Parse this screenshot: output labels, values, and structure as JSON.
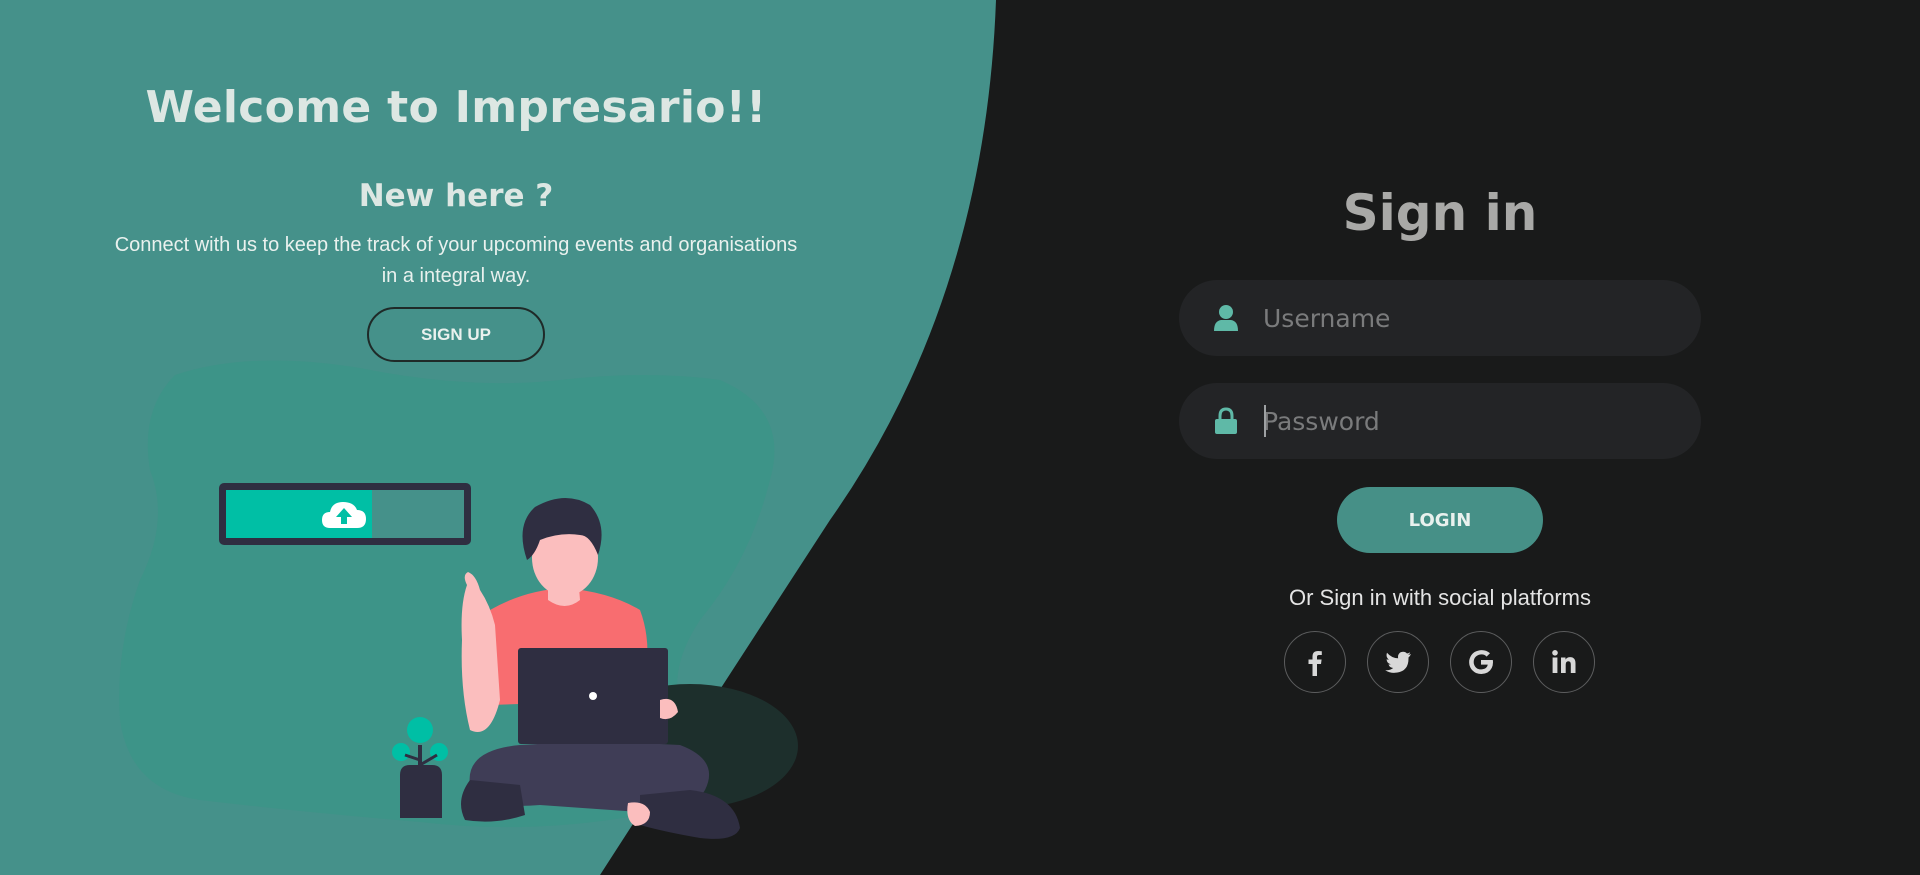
{
  "left": {
    "welcome_title": "Welcome to Impresario!!",
    "new_here": "New here ?",
    "description": "Connect with us to keep the track of your upcoming events and organisations in a integral way.",
    "signup_label": "SIGN UP"
  },
  "right": {
    "title": "Sign in",
    "username": {
      "placeholder": "Username",
      "value": "",
      "icon": "user-icon"
    },
    "password": {
      "placeholder": "Password",
      "value": "",
      "icon": "lock-icon"
    },
    "login_label": "LOGIN",
    "social_text": "Or Sign in with social platforms",
    "social": [
      {
        "name": "facebook",
        "icon": "facebook-icon"
      },
      {
        "name": "twitter",
        "icon": "twitter-icon"
      },
      {
        "name": "google",
        "icon": "google-icon"
      },
      {
        "name": "linkedin",
        "icon": "linkedin-icon"
      }
    ]
  },
  "colors": {
    "teal_panel": "#45918a",
    "dark_bg": "#191a1a",
    "accent": "#469087",
    "icon_teal": "#5fb9a7",
    "upload_fill": "#00bfa5"
  },
  "illustration": {
    "upload_progress_percent": 55
  }
}
